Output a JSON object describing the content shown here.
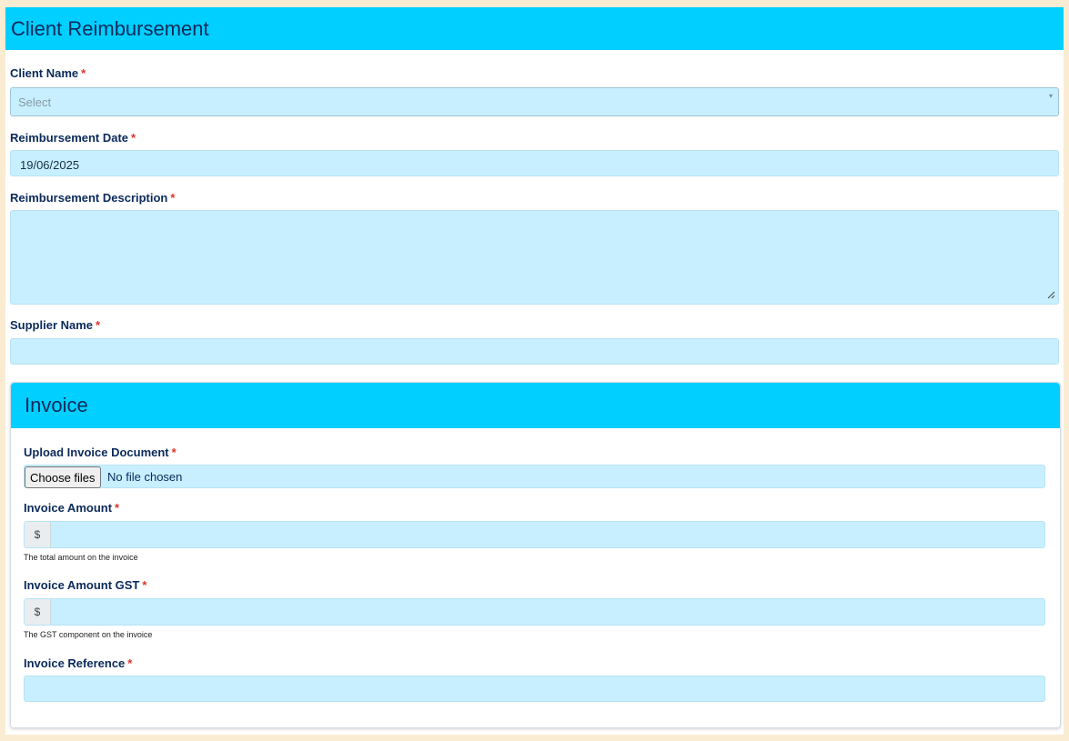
{
  "header": {
    "title": "Client Reimbursement"
  },
  "required_marker": "*",
  "fields": {
    "client_name": {
      "label": "Client Name",
      "placeholder": "Select",
      "arrow": "▾"
    },
    "reimbursement_date": {
      "label": "Reimbursement Date",
      "value": "19/06/2025"
    },
    "reimbursement_description": {
      "label": "Reimbursement Description",
      "value": ""
    },
    "supplier_name": {
      "label": "Supplier Name",
      "value": ""
    }
  },
  "invoice": {
    "title": "Invoice",
    "upload": {
      "label": "Upload Invoice Document",
      "button_label": "Choose files",
      "status": "No file chosen"
    },
    "amount": {
      "label": "Invoice Amount",
      "prefix": "$",
      "help": "The total amount on the invoice",
      "value": ""
    },
    "amount_gst": {
      "label": "Invoice Amount GST",
      "prefix": "$",
      "help": "The GST component on the invoice",
      "value": ""
    },
    "reference": {
      "label": "Invoice Reference",
      "value": ""
    }
  },
  "colors": {
    "header_bg": "#00cfff",
    "input_bg": "#c7efff",
    "page_bg": "#faecd2",
    "label": "#0b2a5b",
    "required": "#e0322b"
  },
  "icons": {
    "dropdown": "chevron-down-icon",
    "resize": "resize-handle-icon"
  }
}
